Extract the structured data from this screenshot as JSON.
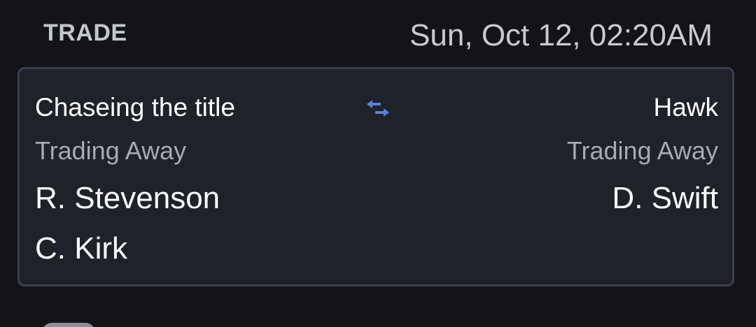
{
  "section": {
    "title": "TRADE",
    "datetime": "Sun, Oct 12, 02:20AM"
  },
  "trade": {
    "left_team": {
      "name": "Chaseing the title",
      "label": "Trading Away",
      "players": [
        "R. Stevenson",
        "C. Kirk"
      ]
    },
    "right_team": {
      "name": "Hawk",
      "label": "Trading Away",
      "players": [
        "D. Swift"
      ]
    },
    "swap_icon": "swap-arrows-icon",
    "accent_color": "#5b7fdc"
  }
}
